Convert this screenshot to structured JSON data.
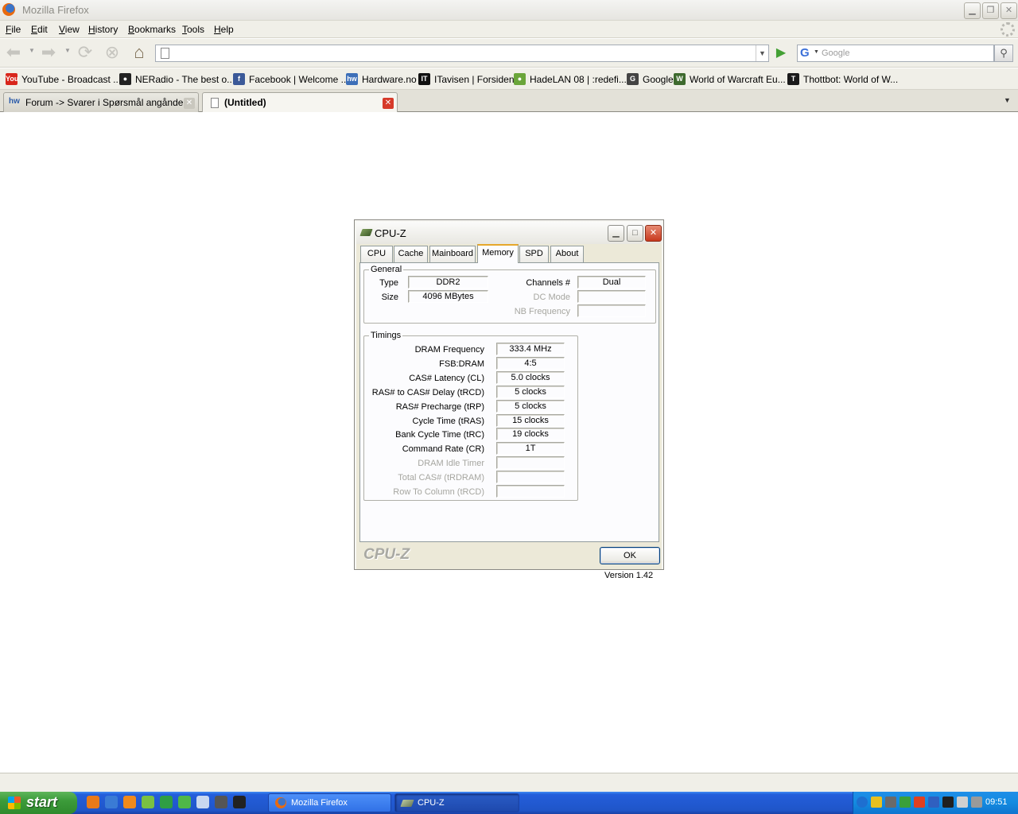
{
  "browser": {
    "window_title": "Mozilla Firefox",
    "menu": [
      "File",
      "Edit",
      "View",
      "History",
      "Bookmarks",
      "Tools",
      "Help"
    ],
    "menu_access_keys": [
      "F",
      "E",
      "V",
      "H",
      "B",
      "T",
      "H"
    ],
    "url_value": "",
    "search_placeholder": "Google",
    "bookmarks": [
      {
        "label": "YouTube - Broadcast ...",
        "icon": "youtube-icon",
        "icon_text": "You",
        "color": "#d8261c"
      },
      {
        "label": "NERadio - The best o...",
        "icon": "neradio-icon",
        "icon_text": "●",
        "color": "#222222"
      },
      {
        "label": "Facebook | Welcome ...",
        "icon": "facebook-icon",
        "icon_text": "f",
        "color": "#3b5998"
      },
      {
        "label": "Hardware.no",
        "icon": "hardware-no-icon",
        "icon_text": "hw",
        "color": "#3d6fb8"
      },
      {
        "label": "ITavisen | Forsiden",
        "icon": "itavisen-icon",
        "icon_text": "IT",
        "color": "#111111"
      },
      {
        "label": "HadeLAN 08 | :redefi...",
        "icon": "hadelan-icon",
        "icon_text": "●",
        "color": "#6aa53a"
      },
      {
        "label": "Google",
        "icon": "google-icon",
        "icon_text": "G",
        "color": "#444444"
      },
      {
        "label": "World of Warcraft Eu...",
        "icon": "wow-icon",
        "icon_text": "W",
        "color": "#3e6a2e"
      },
      {
        "label": "Thottbot: World of W...",
        "icon": "thottbot-icon",
        "icon_text": "T",
        "color": "#1a1a1a"
      }
    ],
    "tabs": [
      {
        "label": "Forum -> Svarer i Spørsmål angånde ...",
        "icon": "hardware-no-icon",
        "icon_text": "hw",
        "active": false
      },
      {
        "label": "(Untitled)",
        "icon": "blank-page-icon",
        "icon_text": "",
        "active": true
      }
    ]
  },
  "cpuz": {
    "title": "CPU-Z",
    "tabs": [
      "CPU",
      "Cache",
      "Mainboard",
      "Memory",
      "SPD",
      "About"
    ],
    "active_tab": "Memory",
    "general": {
      "legend": "General",
      "type_label": "Type",
      "type_value": "DDR2",
      "size_label": "Size",
      "size_value": "4096 MBytes",
      "channels_label": "Channels #",
      "channels_value": "Dual",
      "dc_mode_label": "DC Mode",
      "dc_mode_value": "",
      "nb_freq_label": "NB Frequency",
      "nb_freq_value": ""
    },
    "timings": {
      "legend": "Timings",
      "rows": [
        {
          "label": "DRAM Frequency",
          "value": "333.4 MHz",
          "enabled": true
        },
        {
          "label": "FSB:DRAM",
          "value": "4:5",
          "enabled": true
        },
        {
          "label": "CAS# Latency (CL)",
          "value": "5.0 clocks",
          "enabled": true
        },
        {
          "label": "RAS# to CAS# Delay (tRCD)",
          "value": "5 clocks",
          "enabled": true
        },
        {
          "label": "RAS# Precharge (tRP)",
          "value": "5 clocks",
          "enabled": true
        },
        {
          "label": "Cycle Time (tRAS)",
          "value": "15 clocks",
          "enabled": true
        },
        {
          "label": "Bank Cycle Time (tRC)",
          "value": "19 clocks",
          "enabled": true
        },
        {
          "label": "Command Rate (CR)",
          "value": "1T",
          "enabled": true
        },
        {
          "label": "DRAM Idle Timer",
          "value": "",
          "enabled": false
        },
        {
          "label": "Total CAS# (tRDRAM)",
          "value": "",
          "enabled": false
        },
        {
          "label": "Row To Column (tRCD)",
          "value": "",
          "enabled": false
        }
      ]
    },
    "version": "Version 1.42",
    "brand": "CPU-Z",
    "ok_label": "OK"
  },
  "taskbar": {
    "start_label": "start",
    "quick_launch": [
      {
        "icon": "firefox-icon",
        "color": "#e87a1a"
      },
      {
        "icon": "media-player-icon",
        "color": "#3a7bd5"
      },
      {
        "icon": "vlc-icon",
        "color": "#f08a1c"
      },
      {
        "icon": "green-app-icon",
        "color": "#7ac142"
      },
      {
        "icon": "refresh-app-icon",
        "color": "#2f9e44"
      },
      {
        "icon": "msn-icon",
        "color": "#4fb848"
      },
      {
        "icon": "network-icon",
        "color": "#c8d8f0"
      },
      {
        "icon": "shield-app-icon",
        "color": "#555555"
      },
      {
        "icon": "steam-icon",
        "color": "#222222"
      }
    ],
    "tasks": [
      {
        "label": "Mozilla Firefox",
        "icon": "firefox-icon"
      },
      {
        "label": "CPU-Z",
        "icon": "cpuz-icon"
      }
    ],
    "tray_icons": [
      {
        "icon": "tray-expand-icon",
        "color": "#1e6fd0"
      },
      {
        "icon": "security-shield-icon",
        "color": "#e8c020"
      },
      {
        "icon": "tray-app-icon",
        "color": "#6a6a6a"
      },
      {
        "icon": "tray-temp-icon",
        "color": "#3aa03a"
      },
      {
        "icon": "tray-flag-icon",
        "color": "#e04020"
      },
      {
        "icon": "tray-shield-icon",
        "color": "#3060c0"
      },
      {
        "icon": "tray-monitor-icon",
        "color": "#202020"
      },
      {
        "icon": "volume-icon",
        "color": "#d0d0d0"
      },
      {
        "icon": "tray-misc-icon",
        "color": "#9a9a9a"
      }
    ],
    "clock": "09:51"
  }
}
